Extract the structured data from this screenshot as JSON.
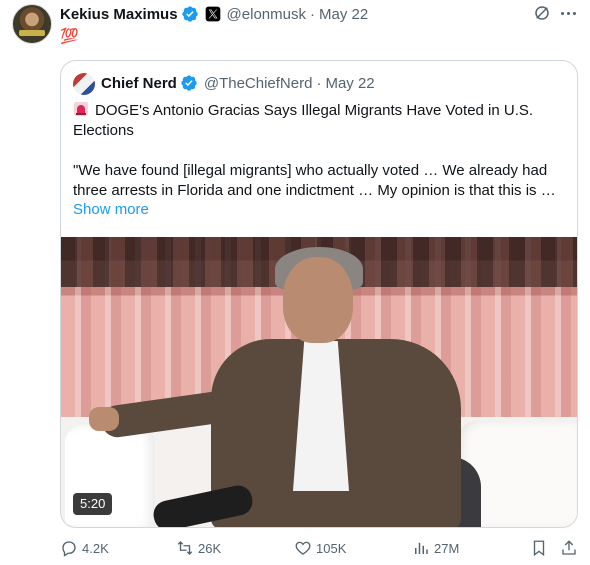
{
  "tweet": {
    "author_name": "Kekius Maximus",
    "author_handle": "@elonmusk",
    "date": "May 22",
    "body": "💯"
  },
  "quote": {
    "author_name": "Chief Nerd",
    "author_handle": "@TheChiefNerd",
    "date": "May 22",
    "headline": "DOGE's Antonio Gracias Says Illegal Migrants Have Voted in U.S. Elections",
    "excerpt": "\"We have found [illegal migrants] who actually voted … We already had three arrests in Florida and one indictment … My opinion is that this is …",
    "show_more": "Show more",
    "video_duration": "5:20"
  },
  "actions": {
    "replies": "4.2K",
    "retweets": "26K",
    "likes": "105K",
    "views": "27M"
  },
  "colors": {
    "link": "#1d9bf0",
    "verified": "#1d9bf0",
    "secondary_text": "#536471"
  }
}
